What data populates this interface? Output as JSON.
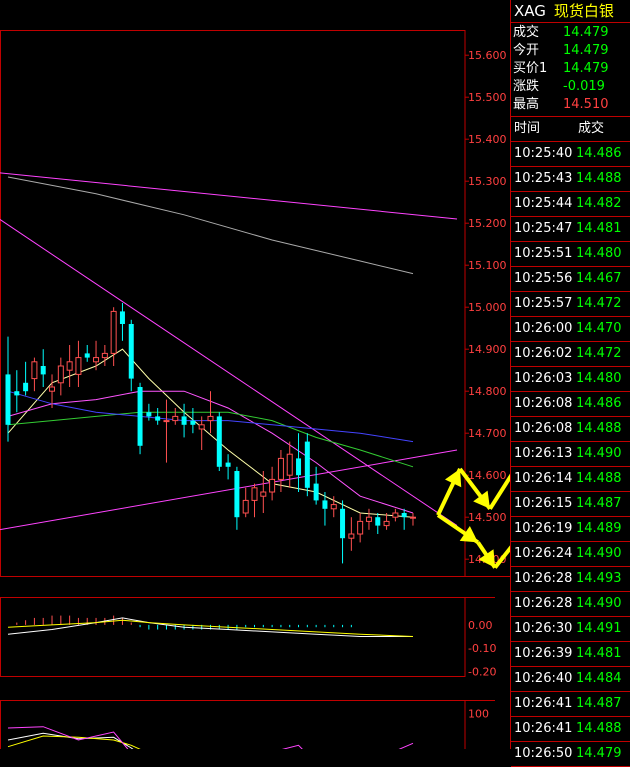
{
  "header": {
    "symbol": "XAG",
    "name": "现货白银"
  },
  "quote": [
    {
      "label": "成交",
      "value": "14.479",
      "color": "#00ff00"
    },
    {
      "label": "今开",
      "value": "14.479",
      "color": "#00ff00"
    },
    {
      "label": "买价1",
      "value": "14.479",
      "color": "#00ff00"
    },
    {
      "label": "涨跌",
      "value": "-0.019",
      "color": "#00ff00"
    },
    {
      "label": "最高",
      "value": "14.510",
      "color": "#ff4040"
    }
  ],
  "trades_header": {
    "time": "时间",
    "price": "成交"
  },
  "trades": [
    {
      "time": "10:25:40",
      "price": "14.486"
    },
    {
      "time": "10:25:43",
      "price": "14.488"
    },
    {
      "time": "10:25:44",
      "price": "14.482"
    },
    {
      "time": "10:25:47",
      "price": "14.481"
    },
    {
      "time": "10:25:51",
      "price": "14.480"
    },
    {
      "time": "10:25:56",
      "price": "14.467"
    },
    {
      "time": "10:25:57",
      "price": "14.472"
    },
    {
      "time": "10:26:00",
      "price": "14.470"
    },
    {
      "time": "10:26:02",
      "price": "14.472"
    },
    {
      "time": "10:26:03",
      "price": "14.480"
    },
    {
      "time": "10:26:08",
      "price": "14.486"
    },
    {
      "time": "10:26:08",
      "price": "14.488"
    },
    {
      "time": "10:26:13",
      "price": "14.490"
    },
    {
      "time": "10:26:14",
      "price": "14.488"
    },
    {
      "time": "10:26:15",
      "price": "14.487"
    },
    {
      "time": "10:26:19",
      "price": "14.489"
    },
    {
      "time": "10:26:24",
      "price": "14.490"
    },
    {
      "time": "10:26:28",
      "price": "14.493"
    },
    {
      "time": "10:26:28",
      "price": "14.490"
    },
    {
      "time": "10:26:30",
      "price": "14.491"
    },
    {
      "time": "10:26:39",
      "price": "14.481"
    },
    {
      "time": "10:26:40",
      "price": "14.484"
    },
    {
      "time": "10:26:41",
      "price": "14.487"
    },
    {
      "time": "10:26:41",
      "price": "14.488"
    },
    {
      "time": "10:26:50",
      "price": "14.479"
    }
  ],
  "colors": {
    "up": "#ff5050",
    "down": "#00ffff",
    "grid": "#c00000",
    "tick": "#ff4040",
    "arrow": "#ffff00"
  },
  "chart_data": [
    {
      "type": "candlestick",
      "ylim": [
        14.36,
        15.66
      ],
      "yticks": [
        "15.600",
        "15.500",
        "15.400",
        "15.300",
        "15.200",
        "15.100",
        "15.000",
        "14.900",
        "14.800",
        "14.700",
        "14.600",
        "14.500",
        "14.400"
      ],
      "candles": [
        {
          "o": 14.84,
          "h": 14.93,
          "l": 14.68,
          "c": 14.72
        },
        {
          "o": 14.8,
          "h": 14.85,
          "l": 14.75,
          "c": 14.79
        },
        {
          "o": 14.82,
          "h": 14.87,
          "l": 14.79,
          "c": 14.8
        },
        {
          "o": 14.83,
          "h": 14.88,
          "l": 14.8,
          "c": 14.87
        },
        {
          "o": 14.86,
          "h": 14.9,
          "l": 14.81,
          "c": 14.84
        },
        {
          "o": 14.8,
          "h": 14.84,
          "l": 14.76,
          "c": 14.81
        },
        {
          "o": 14.82,
          "h": 14.88,
          "l": 14.79,
          "c": 14.86
        },
        {
          "o": 14.85,
          "h": 14.91,
          "l": 14.81,
          "c": 14.87
        },
        {
          "o": 14.84,
          "h": 14.92,
          "l": 14.81,
          "c": 14.88
        },
        {
          "o": 14.89,
          "h": 14.91,
          "l": 14.87,
          "c": 14.88
        },
        {
          "o": 14.87,
          "h": 14.92,
          "l": 14.85,
          "c": 14.88
        },
        {
          "o": 14.88,
          "h": 14.91,
          "l": 14.86,
          "c": 14.89
        },
        {
          "o": 14.89,
          "h": 15.0,
          "l": 14.86,
          "c": 14.99
        },
        {
          "o": 14.99,
          "h": 15.01,
          "l": 14.92,
          "c": 14.96
        },
        {
          "o": 14.96,
          "h": 14.97,
          "l": 14.8,
          "c": 14.83
        },
        {
          "o": 14.81,
          "h": 14.82,
          "l": 14.65,
          "c": 14.67
        },
        {
          "o": 14.75,
          "h": 14.77,
          "l": 14.73,
          "c": 14.74
        },
        {
          "o": 14.74,
          "h": 14.76,
          "l": 14.72,
          "c": 14.73
        },
        {
          "o": 14.73,
          "h": 14.78,
          "l": 14.63,
          "c": 14.73
        },
        {
          "o": 14.73,
          "h": 14.76,
          "l": 14.72,
          "c": 14.74
        },
        {
          "o": 14.74,
          "h": 14.77,
          "l": 14.69,
          "c": 14.72
        },
        {
          "o": 14.73,
          "h": 14.76,
          "l": 14.7,
          "c": 14.72
        },
        {
          "o": 14.71,
          "h": 14.74,
          "l": 14.66,
          "c": 14.72
        },
        {
          "o": 14.73,
          "h": 14.8,
          "l": 14.7,
          "c": 14.74
        },
        {
          "o": 14.74,
          "h": 14.75,
          "l": 14.61,
          "c": 14.62
        },
        {
          "o": 14.63,
          "h": 14.65,
          "l": 14.59,
          "c": 14.62
        },
        {
          "o": 14.61,
          "h": 14.62,
          "l": 14.47,
          "c": 14.5
        },
        {
          "o": 14.51,
          "h": 14.57,
          "l": 14.5,
          "c": 14.54
        },
        {
          "o": 14.54,
          "h": 14.58,
          "l": 14.5,
          "c": 14.57
        },
        {
          "o": 14.55,
          "h": 14.61,
          "l": 14.51,
          "c": 14.56
        },
        {
          "o": 14.56,
          "h": 14.62,
          "l": 14.54,
          "c": 14.59
        },
        {
          "o": 14.59,
          "h": 14.66,
          "l": 14.56,
          "c": 14.64
        },
        {
          "o": 14.6,
          "h": 14.68,
          "l": 14.57,
          "c": 14.65
        },
        {
          "o": 14.64,
          "h": 14.7,
          "l": 14.56,
          "c": 14.6
        },
        {
          "o": 14.68,
          "h": 14.7,
          "l": 14.55,
          "c": 14.57
        },
        {
          "o": 14.58,
          "h": 14.62,
          "l": 14.53,
          "c": 14.54
        },
        {
          "o": 14.54,
          "h": 14.56,
          "l": 14.48,
          "c": 14.52
        },
        {
          "o": 14.52,
          "h": 14.55,
          "l": 14.5,
          "c": 14.53
        },
        {
          "o": 14.52,
          "h": 14.54,
          "l": 14.39,
          "c": 14.45
        },
        {
          "o": 14.45,
          "h": 14.5,
          "l": 14.42,
          "c": 14.46
        },
        {
          "o": 14.46,
          "h": 14.51,
          "l": 14.44,
          "c": 14.49
        },
        {
          "o": 14.49,
          "h": 14.52,
          "l": 14.47,
          "c": 14.5
        },
        {
          "o": 14.5,
          "h": 14.51,
          "l": 14.46,
          "c": 14.48
        },
        {
          "o": 14.48,
          "h": 14.51,
          "l": 14.47,
          "c": 14.49
        },
        {
          "o": 14.5,
          "h": 14.52,
          "l": 14.49,
          "c": 14.51
        },
        {
          "o": 14.51,
          "h": 14.52,
          "l": 14.47,
          "c": 14.5
        },
        {
          "o": 14.5,
          "h": 14.51,
          "l": 14.48,
          "c": 14.5
        }
      ],
      "ma_lines": [
        {
          "color": "#ffffaa",
          "values": [
            [
              0,
              14.7
            ],
            [
              5,
              14.82
            ],
            [
              10,
              14.86
            ],
            [
              13,
              14.9
            ],
            [
              16,
              14.83
            ],
            [
              20,
              14.75
            ],
            [
              25,
              14.66
            ],
            [
              30,
              14.58
            ],
            [
              35,
              14.56
            ],
            [
              40,
              14.51
            ],
            [
              46,
              14.5
            ]
          ]
        },
        {
          "color": "#ff55ff",
          "values": [
            [
              0,
              14.74
            ],
            [
              5,
              14.77
            ],
            [
              10,
              14.78
            ],
            [
              15,
              14.8
            ],
            [
              20,
              14.8
            ],
            [
              25,
              14.76
            ],
            [
              30,
              14.7
            ],
            [
              35,
              14.63
            ],
            [
              40,
              14.55
            ],
            [
              46,
              14.51
            ]
          ]
        },
        {
          "color": "#33cc33",
          "values": [
            [
              0,
              14.72
            ],
            [
              5,
              14.73
            ],
            [
              10,
              14.74
            ],
            [
              15,
              14.75
            ],
            [
              20,
              14.75
            ],
            [
              25,
              14.75
            ],
            [
              30,
              14.73
            ],
            [
              35,
              14.69
            ],
            [
              40,
              14.66
            ],
            [
              46,
              14.62
            ]
          ]
        },
        {
          "color": "#4444ff",
          "values": [
            [
              0,
              14.8
            ],
            [
              5,
              14.77
            ],
            [
              10,
              14.75
            ],
            [
              15,
              14.74
            ],
            [
              20,
              14.73
            ],
            [
              25,
              14.73
            ],
            [
              30,
              14.72
            ],
            [
              35,
              14.71
            ],
            [
              40,
              14.7
            ],
            [
              46,
              14.68
            ]
          ]
        },
        {
          "color": "#aaaaaa",
          "values": [
            [
              0,
              15.31
            ],
            [
              10,
              15.27
            ],
            [
              20,
              15.22
            ],
            [
              30,
              15.16
            ],
            [
              40,
              15.11
            ],
            [
              46,
              15.08
            ]
          ]
        }
      ],
      "trend_lines": [
        {
          "color": "#ff44ff",
          "from": [
            -1,
            15.32
          ],
          "to": [
            51,
            15.21
          ]
        },
        {
          "color": "#ff44ff",
          "from": [
            -1,
            15.21
          ],
          "to": [
            51,
            14.48
          ]
        },
        {
          "color": "#ff44ff",
          "from": [
            -1,
            14.47
          ],
          "to": [
            51,
            14.66
          ]
        }
      ]
    },
    {
      "type": "macd",
      "ylim": [
        -0.22,
        0.12
      ],
      "yticks": [
        "0.00",
        "-0.10",
        "-0.20"
      ],
      "dif": [
        [
          0,
          -0.04
        ],
        [
          5,
          -0.02
        ],
        [
          10,
          0.01
        ],
        [
          13,
          0.03
        ],
        [
          16,
          0.01
        ],
        [
          20,
          -0.01
        ],
        [
          25,
          -0.02
        ],
        [
          30,
          -0.03
        ],
        [
          35,
          -0.04
        ],
        [
          40,
          -0.05
        ],
        [
          46,
          -0.05
        ]
      ],
      "dea": [
        [
          0,
          -0.01
        ],
        [
          5,
          0.0
        ],
        [
          10,
          0.01
        ],
        [
          13,
          0.02
        ],
        [
          16,
          0.01
        ],
        [
          20,
          0.0
        ],
        [
          25,
          -0.01
        ],
        [
          30,
          -0.02
        ],
        [
          35,
          -0.03
        ],
        [
          40,
          -0.04
        ],
        [
          46,
          -0.05
        ]
      ],
      "hist": [
        0.0,
        0.01,
        0.02,
        0.03,
        0.03,
        0.04,
        0.04,
        0.04,
        0.03,
        0.03,
        0.03,
        0.03,
        0.04,
        0.03,
        0.01,
        -0.01,
        -0.02,
        -0.02,
        -0.02,
        -0.02,
        -0.02,
        -0.02,
        -0.02,
        -0.02,
        -0.02,
        -0.02,
        -0.02,
        -0.01,
        -0.01,
        -0.01,
        -0.01,
        -0.01,
        -0.01,
        -0.01,
        -0.01,
        -0.01,
        -0.01,
        -0.01,
        -0.01,
        -0.01,
        0.0,
        0.0,
        0.0,
        0.0,
        0.0,
        0.0,
        0.0
      ]
    },
    {
      "type": "kdj",
      "ylim": [
        0,
        120
      ],
      "yticks": [
        "100"
      ],
      "k": [
        [
          0,
          60
        ],
        [
          4,
          70
        ],
        [
          8,
          62
        ],
        [
          12,
          64
        ],
        [
          14,
          48
        ],
        [
          16,
          28
        ],
        [
          20,
          38
        ],
        [
          24,
          30
        ],
        [
          27,
          20
        ],
        [
          30,
          34
        ],
        [
          33,
          40
        ],
        [
          36,
          24
        ],
        [
          38,
          18
        ],
        [
          41,
          28
        ],
        [
          43,
          30
        ],
        [
          46,
          40
        ]
      ],
      "d": [
        [
          0,
          50
        ],
        [
          4,
          66
        ],
        [
          8,
          64
        ],
        [
          12,
          60
        ],
        [
          14,
          52
        ],
        [
          16,
          40
        ],
        [
          20,
          36
        ],
        [
          24,
          32
        ],
        [
          27,
          26
        ],
        [
          30,
          30
        ],
        [
          33,
          34
        ],
        [
          36,
          30
        ],
        [
          38,
          24
        ],
        [
          41,
          26
        ],
        [
          43,
          28
        ],
        [
          46,
          34
        ]
      ],
      "j": [
        [
          0,
          78
        ],
        [
          4,
          80
        ],
        [
          8,
          60
        ],
        [
          12,
          72
        ],
        [
          14,
          40
        ],
        [
          16,
          5
        ],
        [
          20,
          44
        ],
        [
          24,
          26
        ],
        [
          27,
          8
        ],
        [
          30,
          42
        ],
        [
          33,
          52
        ],
        [
          36,
          12
        ],
        [
          38,
          6
        ],
        [
          41,
          32
        ],
        [
          43,
          38
        ],
        [
          46,
          55
        ]
      ]
    }
  ]
}
